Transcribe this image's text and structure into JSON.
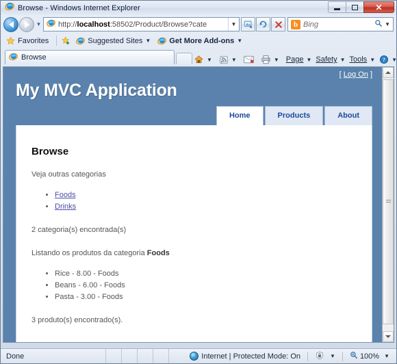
{
  "window": {
    "title": "Browse - Windows Internet Explorer",
    "minimize_label": "Minimize",
    "maximize_label": "Maximize",
    "close_label": "Close",
    "close_glyph": "✕"
  },
  "navigation": {
    "back_label": "Back",
    "forward_label": "Forward",
    "recent_pages_caret": "▼",
    "address": {
      "protocol": "http://",
      "host": "localhost",
      "path": ":58502/Product/Browse?cate",
      "full": "http://localhost:58502/Product/Browse?cate",
      "dropdown_caret": "▼"
    },
    "compat_view_label": "Compatibility View",
    "refresh_label": "Refresh",
    "refresh_glyph": "↻",
    "stop_label": "Stop",
    "stop_glyph": "✕",
    "search": {
      "provider_initial": "b",
      "placeholder": "Bing",
      "value": "",
      "go_glyph": "🔍",
      "caret": "▼"
    }
  },
  "favorites_bar": {
    "favorites_label": "Favorites",
    "add_to_favorites_label": "Add to Favorites Bar",
    "suggested_sites_label": "Suggested Sites",
    "get_more_addons_label": "Get More Add-ons",
    "caret": "▼"
  },
  "tabs": {
    "items": [
      {
        "label": "Browse",
        "active": true
      }
    ],
    "new_tab_label": "New Tab"
  },
  "command_bar": {
    "home_label": "Home",
    "feeds_label": "View feeds",
    "read_mail_label": "Read mail",
    "print_label": "Print",
    "page_label": "Page",
    "safety_label": "Safety",
    "tools_label": "Tools",
    "help_label": "Help",
    "overflow_label": "»",
    "caret": "▼"
  },
  "site": {
    "logon_open_bracket": "[",
    "logon_label": "Log On",
    "logon_close_bracket": "]",
    "title": "My MVC Application",
    "menu": [
      {
        "label": "Home",
        "selected": true
      },
      {
        "label": "Products",
        "selected": false
      },
      {
        "label": "About",
        "selected": false
      }
    ],
    "accent_color": "#5a82ac",
    "link_color": "#4b4ba8",
    "menu_text_color": "#1c4a9c"
  },
  "content": {
    "heading": "Browse",
    "categories_intro": "Veja outras categorias",
    "category_links": [
      {
        "label": "Foods"
      },
      {
        "label": "Drinks"
      }
    ],
    "categories_count_text": "2 categoria(s) encontrada(s)",
    "products_intro_prefix": "Listando os produtos da categoria ",
    "products_intro_category": "Foods",
    "products": [
      {
        "text": "Rice - 8.00 - Foods"
      },
      {
        "text": "Beans - 6.00 - Foods"
      },
      {
        "text": "Pasta - 3.00 - Foods"
      }
    ],
    "products_count_text": "3 produto(s) encontrado(s)."
  },
  "scrollbar": {
    "up_label": "Scroll up",
    "down_label": "Scroll down",
    "thumb_label": "Scroll thumb"
  },
  "status_bar": {
    "status_text": "Done",
    "zone_text": "Internet | Protected Mode: On",
    "privacy_caret": "▼",
    "zoom_level": "100%",
    "zoom_caret": "▼"
  }
}
